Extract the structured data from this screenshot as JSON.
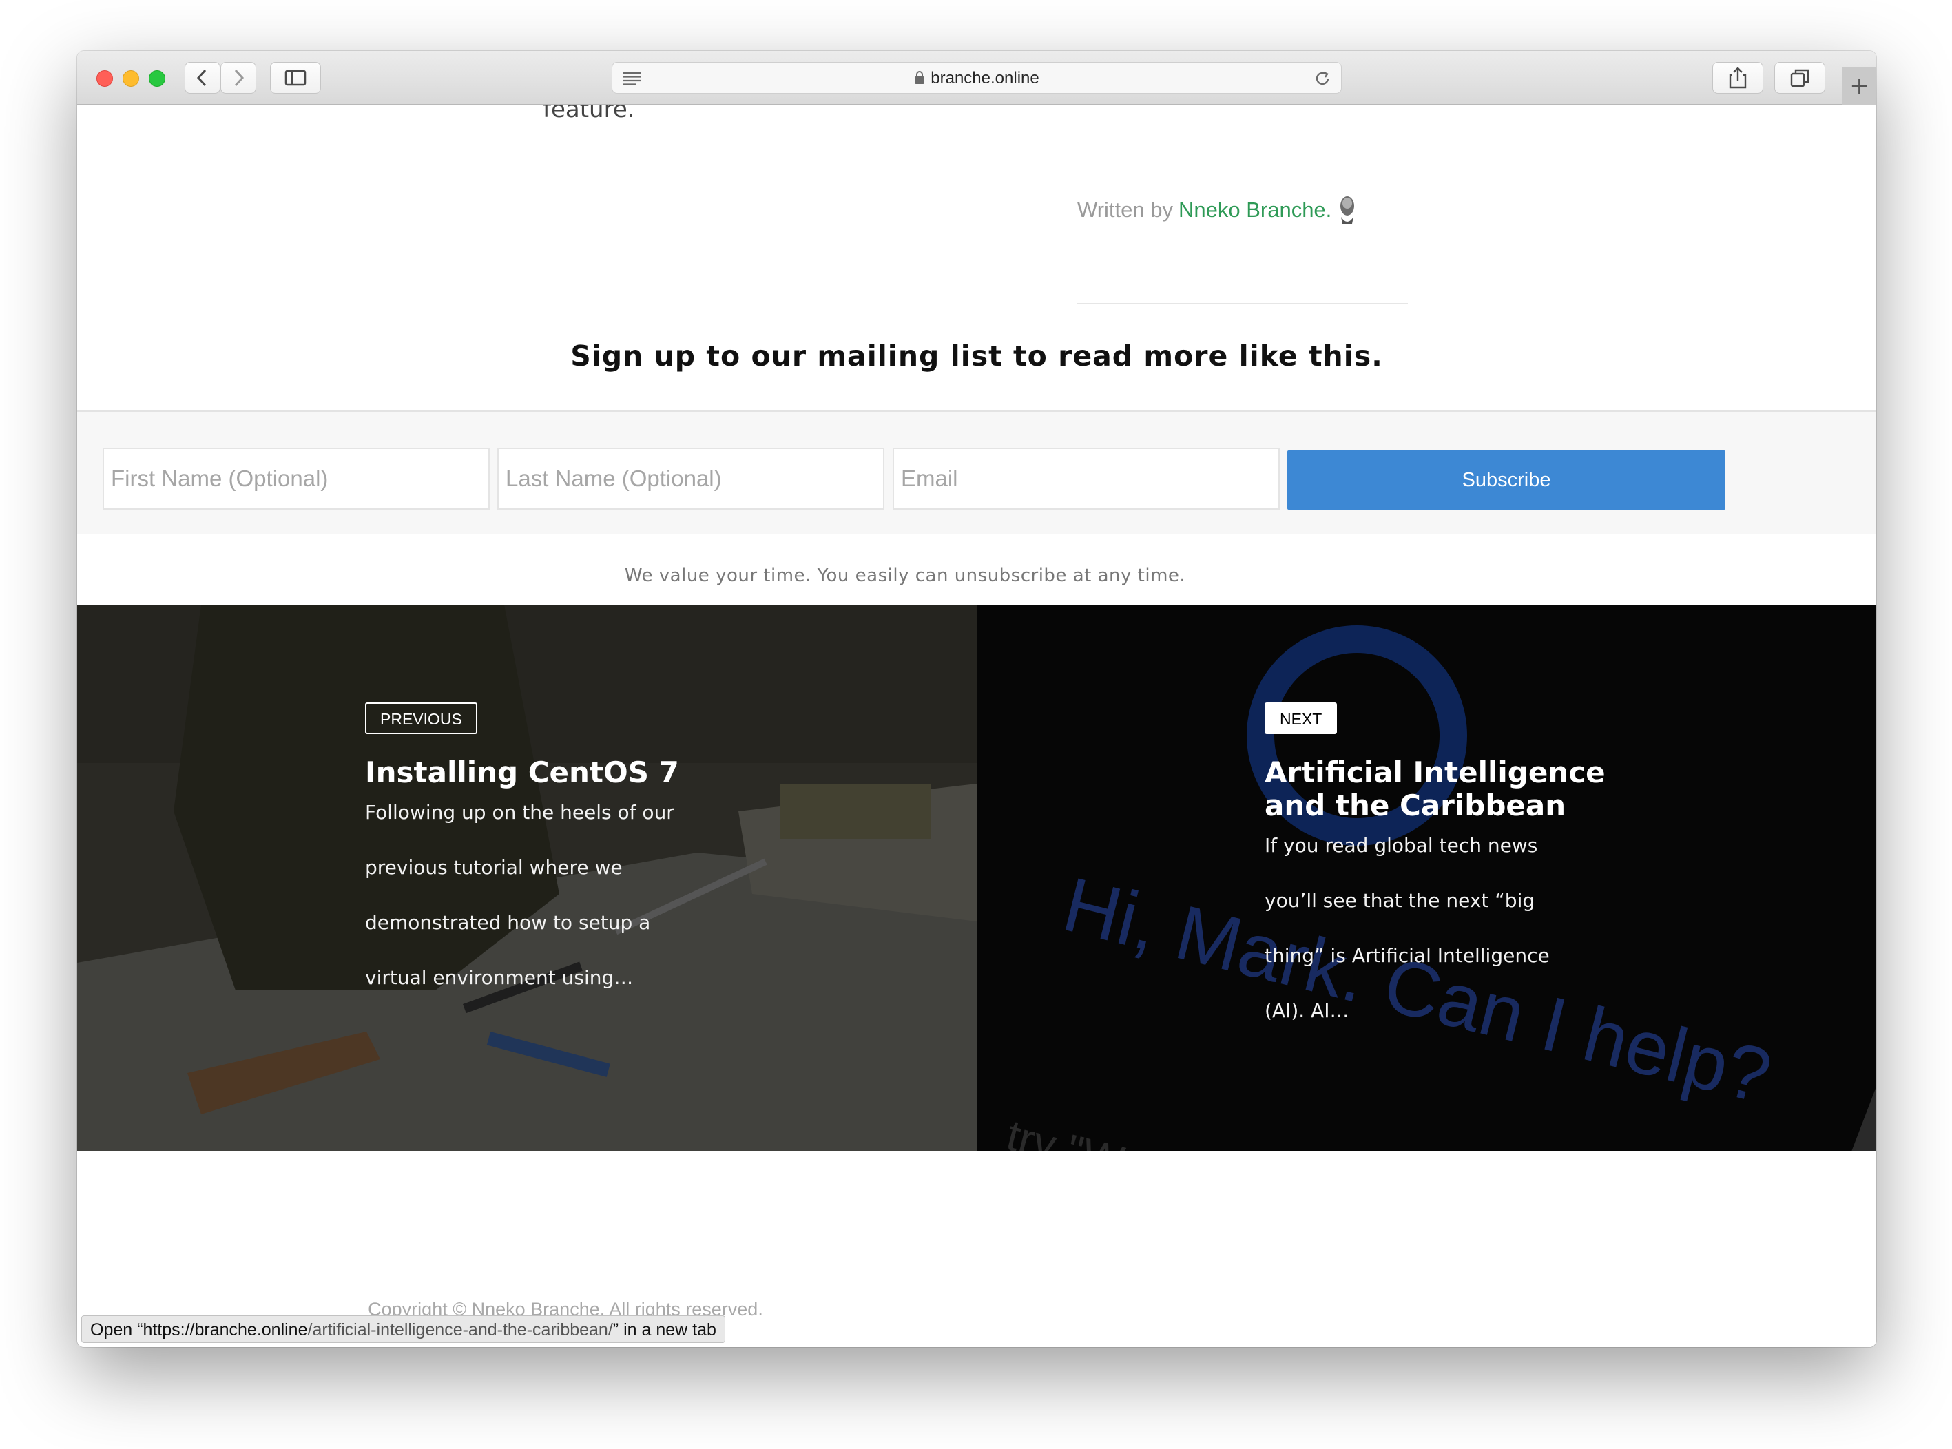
{
  "browser": {
    "address": "branche.online"
  },
  "article": {
    "trailing_text": "feature.",
    "written_by_label": "Written by",
    "author_name": "Nneko Branche.",
    "mailing_heading": "Sign up to our mailing list to read more like this."
  },
  "signup": {
    "first_name_placeholder": "First Name (Optional)",
    "last_name_placeholder": "Last Name (Optional)",
    "email_placeholder": "Email",
    "subscribe_label": "Subscribe",
    "note": "We value your time. You easily can unsubscribe at any time."
  },
  "post_nav": {
    "previous": {
      "tag": "PREVIOUS",
      "title": "Installing CentOS 7",
      "excerpt": "Following up on the heels of our previous tutorial where we demonstrated how to setup a virtual environment using…"
    },
    "next": {
      "tag": "NEXT",
      "title": "Artificial Intelligence and the Caribbean",
      "excerpt": "If you read global tech news you’ll see that the next “big thing” is Artificial Intelligence (AI). AI…",
      "image_text": "Hi, Mark. Can I help?",
      "image_text_2": "try \"W"
    }
  },
  "footer": {
    "copyright": "Copyright © Nneko Branche. All rights reserved."
  },
  "status_bar": {
    "prefix": "Open “",
    "url_host": "https://branche.online",
    "url_path": "/artificial-intelligence-and-the-caribbean/",
    "suffix": "” in a new tab"
  },
  "colors": {
    "accent_green": "#2e9a56",
    "subscribe_blue": "#3d88d4"
  }
}
